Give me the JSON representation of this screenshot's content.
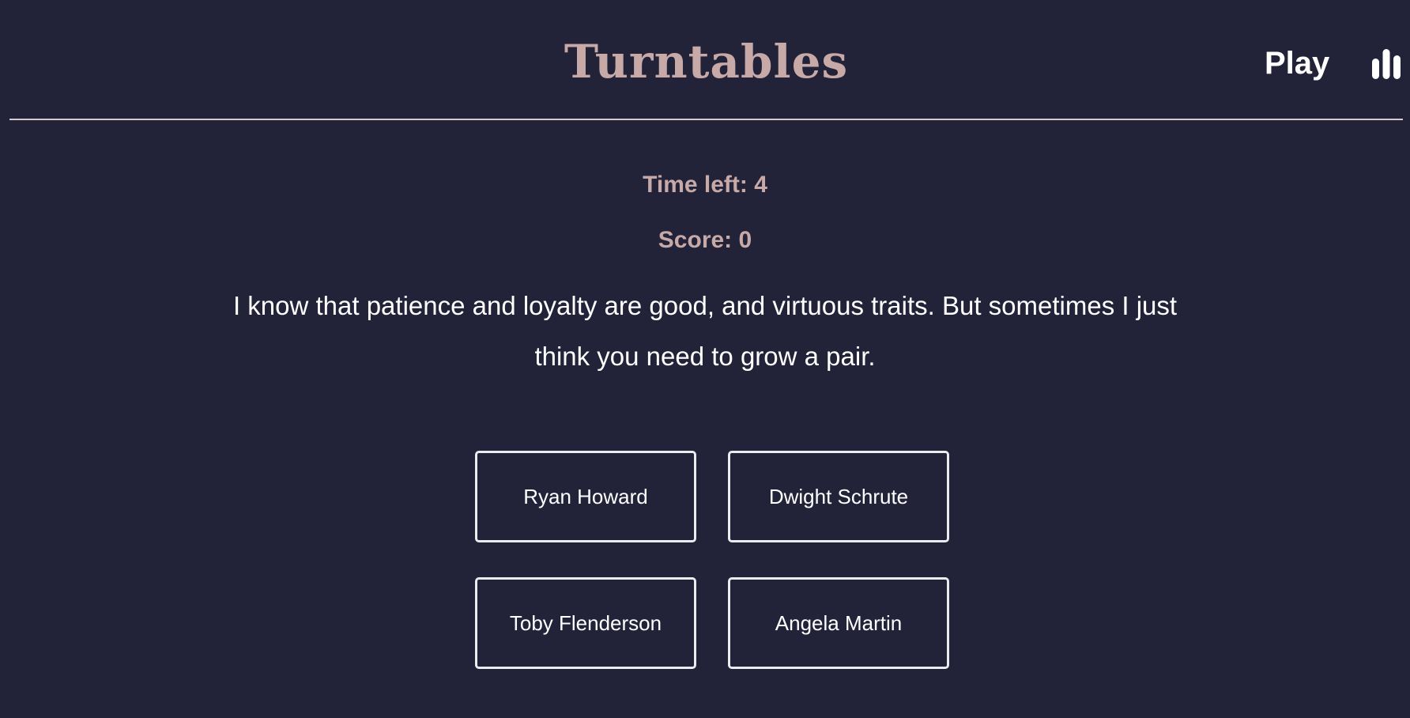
{
  "header": {
    "title": "Turntables",
    "play_label": "Play",
    "stats_icon": "bar-chart-icon"
  },
  "game": {
    "time_left": "Time left: 4",
    "score": "Score: 0",
    "quote": "I know that patience and loyalty are good, and virtuous traits. But sometimes I just think you need to grow a pair.",
    "choices": [
      {
        "label": "Ryan Howard"
      },
      {
        "label": "Dwight Schrute"
      },
      {
        "label": "Toby Flenderson"
      },
      {
        "label": "Angela Martin"
      }
    ]
  },
  "colors": {
    "background": "#222238",
    "accent": "#c7aaa7",
    "text": "#ffffff",
    "border": "#ececf0"
  }
}
